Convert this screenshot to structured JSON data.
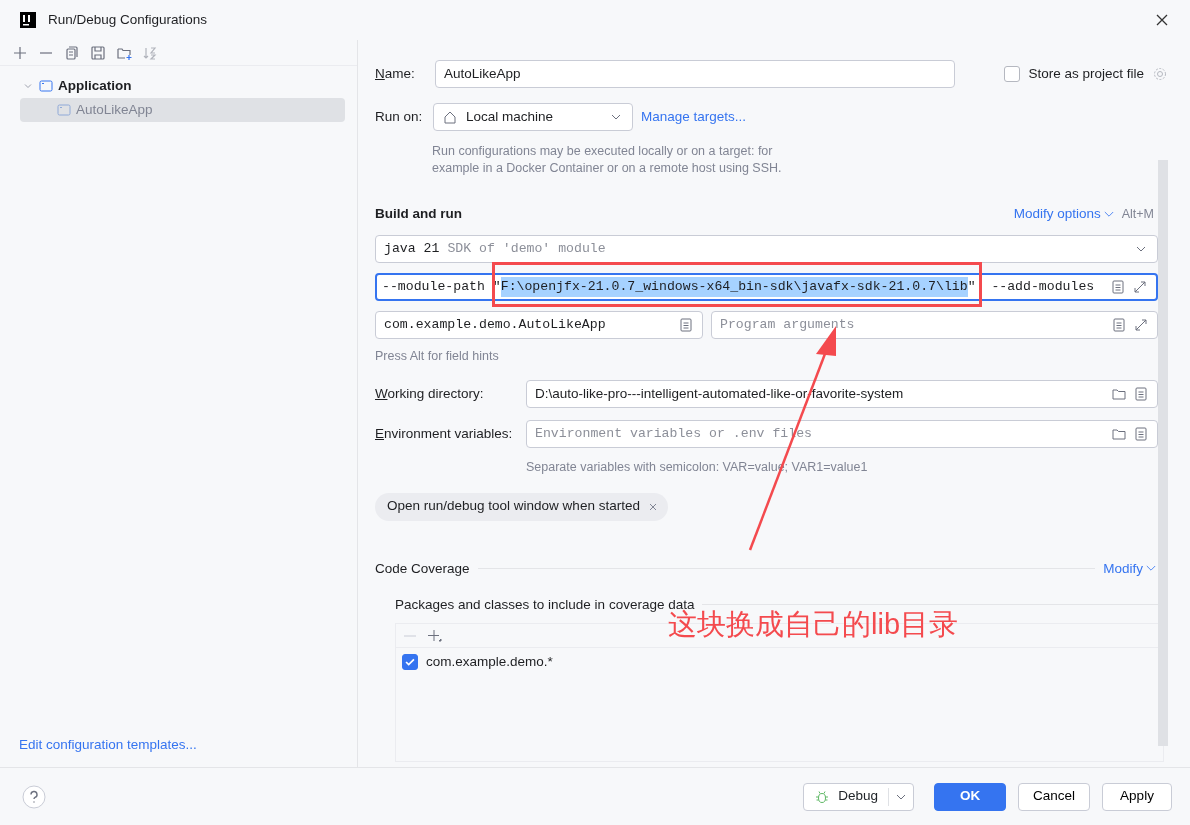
{
  "window": {
    "title": "Run/Debug Configurations"
  },
  "tree": [
    {
      "label": "Application",
      "expanded": true,
      "selected": false,
      "children": [
        {
          "label": "AutoLikeApp",
          "selected": true
        }
      ]
    }
  ],
  "templates_link": "Edit configuration templates...",
  "form": {
    "name_label": {
      "text": "Name:",
      "mnemonic": true
    },
    "name_value": "AutoLikeApp",
    "store_label": "Store as project file",
    "store_checked": false,
    "run_on_label": {
      "text": "Run on:",
      "mnemonic": false
    },
    "run_on_value": "Local machine",
    "manage_link": "Manage targets...",
    "run_on_hint": "Run configurations may be executed locally or on a target: for example in a Docker Container or on a remote host using SSH."
  },
  "build_run": {
    "title": "Build and run",
    "modify_link": "Modify options",
    "shortcut": "Alt+M",
    "jdk_main": "java 21",
    "jdk_detail": "SDK of 'demo' module",
    "vm_prefix": "--module-path \"",
    "vm_selected": "F:\\openjfx-21.0.7_windows-x64_bin-sdk\\javafx-sdk-21.0.7\\lib",
    "vm_suffix": "\"  --add-modules",
    "main_class": "com.example.demo.AutoLikeApp",
    "args_placeholder": "Program arguments",
    "hint": "Press Alt for field hints"
  },
  "working_dir": {
    "label": {
      "text": "Working directory:",
      "mnemonic": true
    },
    "value": "D:\\auto-like-pro---intelligent-automated-like-or-favorite-system"
  },
  "env": {
    "label": {
      "text": "Environment variables:",
      "mnemonic": true
    },
    "placeholder": "Environment variables or .env files",
    "hint": "Separate variables with semicolon: VAR=value; VAR1=value1"
  },
  "chips": [
    {
      "label": "Open run/debug tool window when started"
    }
  ],
  "coverage": {
    "title": "Code Coverage",
    "modify_link": "Modify",
    "packages_label": "Packages and classes to include in coverage data",
    "patterns": [
      {
        "label": "com.example.demo.*",
        "checked": true
      }
    ]
  },
  "footer": {
    "debug": "Debug",
    "ok": "OK",
    "cancel": "Cancel",
    "apply": "Apply"
  },
  "annotation": {
    "text": "这块换成自己的lib目录"
  }
}
